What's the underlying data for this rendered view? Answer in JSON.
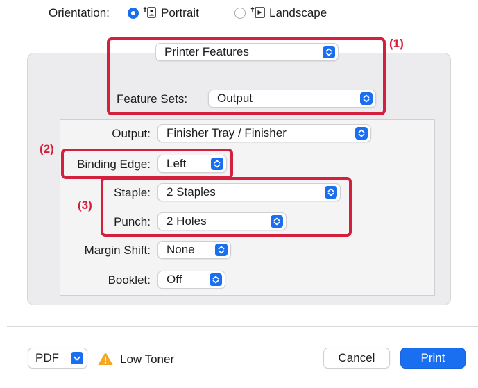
{
  "orientation": {
    "label": "Orientation:",
    "portrait_label": "Portrait",
    "landscape_label": "Landscape",
    "selected": "Portrait"
  },
  "printer_features_popup": "Printer Features",
  "feature_sets": {
    "label": "Feature Sets:",
    "value": "Output"
  },
  "options": {
    "output": {
      "label": "Output:",
      "value": "Finisher Tray / Finisher"
    },
    "binding_edge": {
      "label": "Binding Edge:",
      "value": "Left"
    },
    "staple": {
      "label": "Staple:",
      "value": "2 Staples"
    },
    "punch": {
      "label": "Punch:",
      "value": "2 Holes"
    },
    "margin_shift": {
      "label": "Margin Shift:",
      "value": "None"
    },
    "booklet": {
      "label": "Booklet:",
      "value": "Off"
    }
  },
  "callouts": {
    "c1": "(1)",
    "c2": "(2)",
    "c3": "(3)"
  },
  "footer": {
    "pdf_label": "PDF",
    "warning_text": "Low Toner",
    "cancel_label": "Cancel",
    "print_label": "Print"
  },
  "colors": {
    "accent": "#1a6ef0",
    "callout": "#d41f3d",
    "warning": "#f5a623"
  },
  "icons": [
    "radio-selected-icon",
    "radio-unselected-icon",
    "portrait-icon",
    "landscape-icon",
    "chevron-updown-icon",
    "chevron-down-icon",
    "warning-icon"
  ]
}
